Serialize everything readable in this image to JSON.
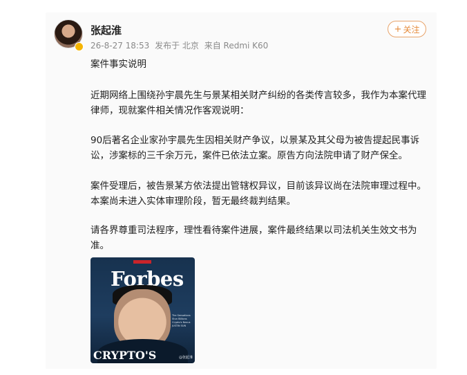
{
  "post": {
    "username": "张起淮",
    "meta": {
      "date": "26-8-27 18:53",
      "location": "发布于 北京",
      "device": "来自 Redmi K60"
    },
    "follow_label": "关注",
    "follow_plus": "+",
    "paragraphs": [
      [
        "案件事实说明"
      ],
      [
        "近期网络上围绕孙宇晨先生与景某相关财产纠纷的各类传言较多，我作为本案代理",
        "律师，现就案件相关情况作客观说明："
      ],
      [
        "90后著名企业家孙宇晨先生因相关财产争议，以景某及其父母为被告提起民事诉",
        "讼，涉案标的三千余万元，案件已依法立案。原告方向法院申请了财产保全。"
      ],
      [
        "案件受理后，被告景某方依法提出管辖权异议，目前该异议尚在法院审理过程中。",
        "本案尚未进入实体审理阶段，暂无最终裁判结果。"
      ],
      [
        "请各界尊重司法程序，理性看待案件进展，案件最终结果以司法机关生效文书为",
        "准。"
      ]
    ],
    "image": {
      "magazine_title": "Forbes",
      "headline": "CRYPTO'S",
      "cover_blurb": "The Sensations Stun Billions Crypto's Nexus JUSTIN SUN",
      "watermark": "@张起淮"
    }
  }
}
